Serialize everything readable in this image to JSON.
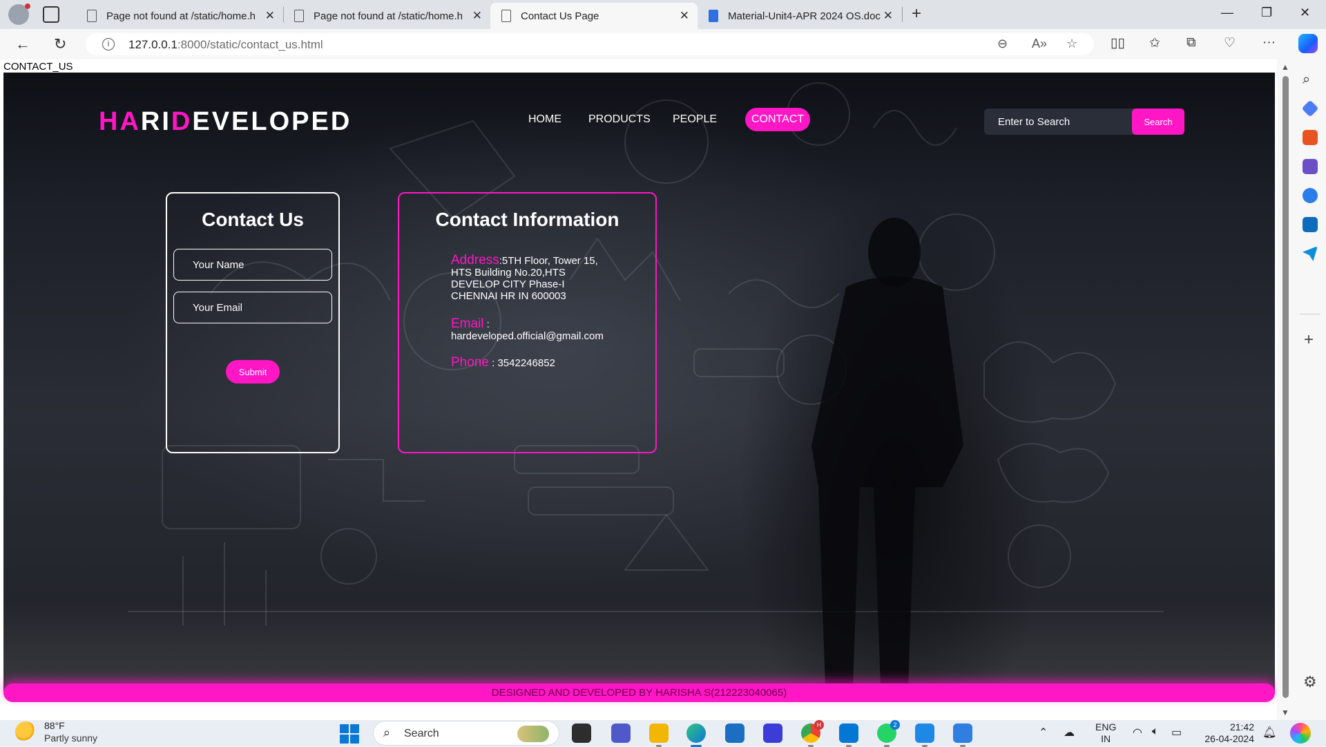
{
  "browser": {
    "tabs": [
      {
        "label": "Page not found at /static/home.h",
        "active": false
      },
      {
        "label": "Page not found at /static/home.h",
        "active": false
      },
      {
        "label": "Contact Us Page",
        "active": true
      },
      {
        "label": "Material-Unit4-APR 2024 OS.doc",
        "active": false
      }
    ],
    "url_host": "127.0.0.1",
    "url_path": ":8000/static/contact_us.html",
    "zoom_icon": "zoom-out-icon"
  },
  "page": {
    "pre_text": "CONTACT_US",
    "logo": {
      "part1": "HA",
      "part2": "RI",
      "part3": "D",
      "part4": "EVELOPED"
    },
    "nav": [
      "HOME",
      "PRODUCTS",
      "PEOPLE",
      "CONTACT"
    ],
    "active_nav": "CONTACT",
    "search": {
      "placeholder": "Enter to Search",
      "button": "Search"
    },
    "form": {
      "title": "Contact Us",
      "name_placeholder": "Your Name",
      "email_placeholder": "Your Email",
      "submit": "Submit"
    },
    "info": {
      "title": "Contact Information",
      "address_label": "Address",
      "address_lines": [
        ":5TH Floor, Tower 15,",
        "HTS Building No.20,HTS",
        "DEVELOP CITY Phase-I",
        "CHENNAI HR IN 600003"
      ],
      "email_label": "Email",
      "email_sep": " :",
      "email_value": "hardeveloped.official@gmail.com",
      "phone_label": "Phone",
      "phone_value": " : 3542246852"
    },
    "footer": "DESIGNED AND DEVELOPED BY HARISHA S(212223040065)",
    "accent_color": "#ff16c5"
  },
  "taskbar": {
    "weather_temp": "88°F",
    "weather_desc": "Partly sunny",
    "search_label": "Search",
    "lang_line1": "ENG",
    "lang_line2": "IN",
    "time": "21:42",
    "date": "26-04-2024",
    "teams_badge": "H",
    "whatsapp_badge": "2"
  }
}
